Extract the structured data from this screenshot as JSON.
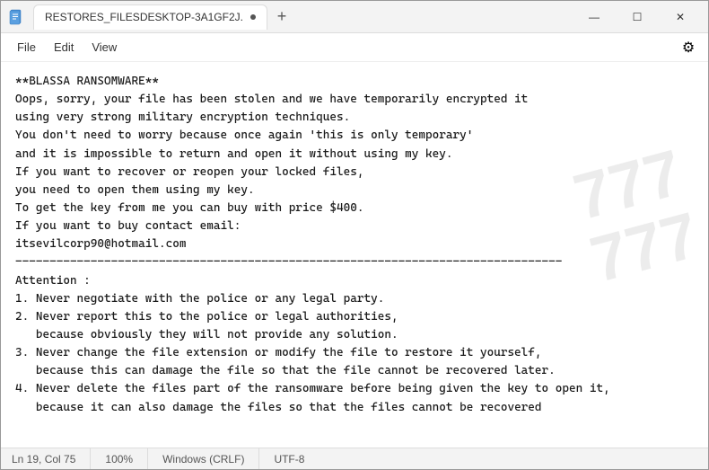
{
  "titlebar": {
    "icon": "📄",
    "tab_label": "RESTORES_FILESDESKTOP-3A1GF2J.",
    "new_tab_label": "+",
    "minimize_label": "—",
    "maximize_label": "☐",
    "close_label": "✕"
  },
  "menubar": {
    "file_label": "File",
    "edit_label": "Edit",
    "view_label": "View",
    "settings_icon": "⚙"
  },
  "content": {
    "text": "**BLASSA RANSOMWARE**\nOops, sorry, your file has been stolen and we have temporarily encrypted it\nusing very strong military encryption techniques.\nYou don't need to worry because once again 'this is only temporary'\nand it is impossible to return and open it without using my key.\nIf you want to recover or reopen your locked files,\nyou need to open them using my key.\nTo get the key from me you can buy with price $400.\nIf you want to buy contact email:\nitsevilcorp90@hotmail.com\n--------------------------------------------------------------------------------\nAttention :\n1. Never negotiate with the police or any legal party.\n2. Never report this to the police or legal authorities,\n   because obviously they will not provide any solution.\n3. Never change the file extension or modify the file to restore it yourself,\n   because this can damage the file so that the file cannot be recovered later.\n4. Never delete the files part of the ransomware before being given the key to open it,\n   because it can also damage the files so that the files cannot be recovered"
  },
  "statusbar": {
    "position": "Ln 19, Col 75",
    "zoom": "100%",
    "line_ending": "Windows (CRLF)",
    "encoding": "UTF-8"
  },
  "watermark": {
    "line1": "777",
    "line2": "777"
  }
}
